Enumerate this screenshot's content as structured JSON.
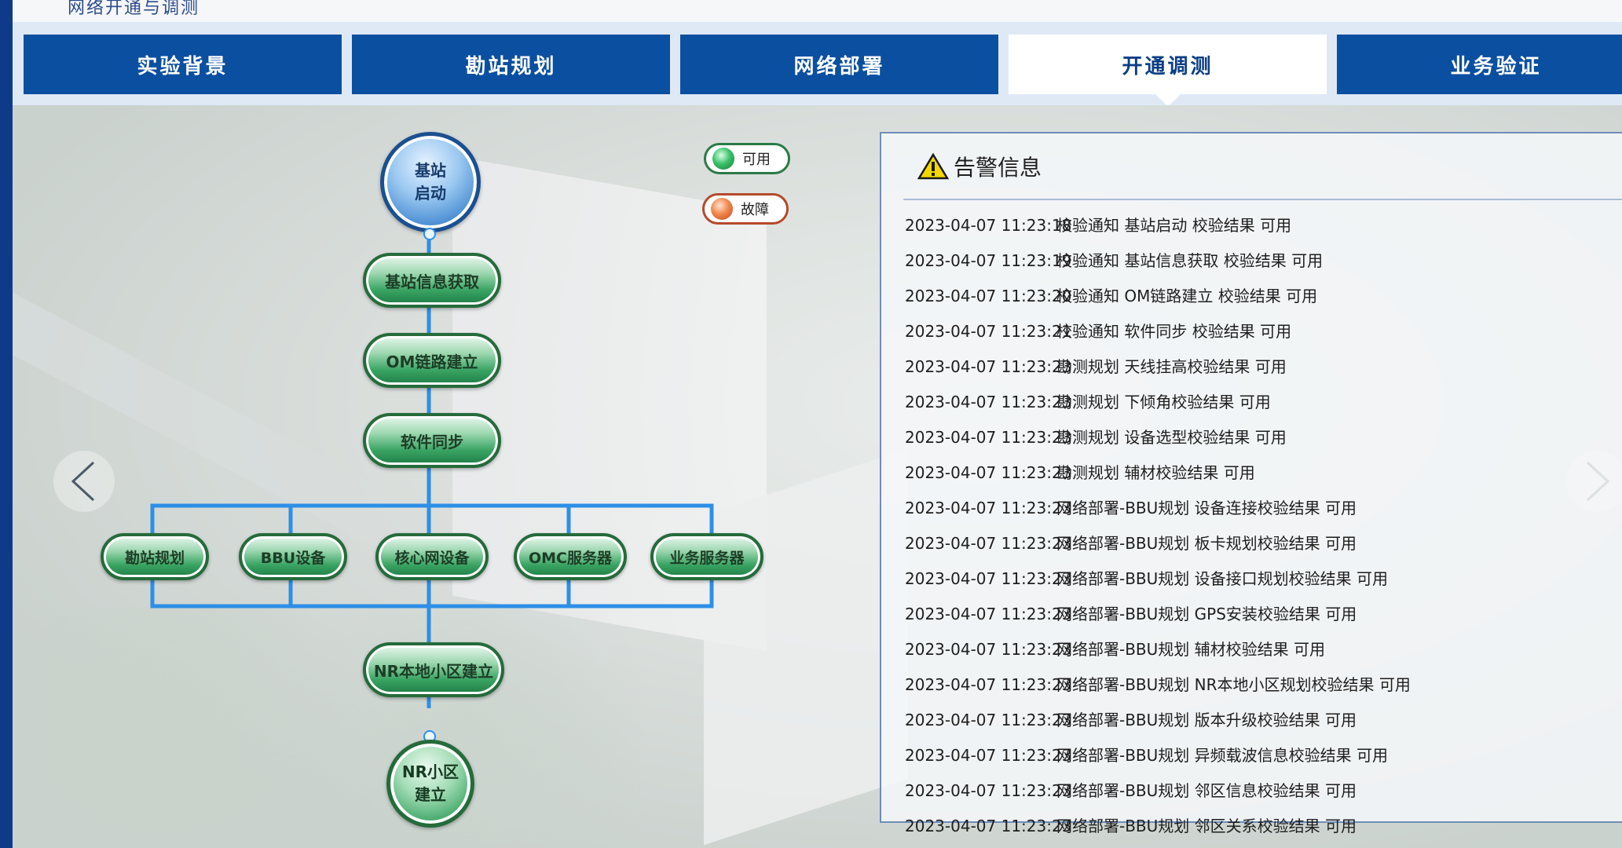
{
  "breadcrumb": "网络开通与调测",
  "tabs": [
    {
      "label": "实验背景",
      "active": false
    },
    {
      "label": "勘站规划",
      "active": false
    },
    {
      "label": "网络部署",
      "active": false
    },
    {
      "label": "开通调测",
      "active": true
    },
    {
      "label": "业务验证",
      "active": false
    }
  ],
  "diagram": {
    "start_line1": "基站",
    "start_line2": "启动",
    "info": "基站信息获取",
    "om": "OM链路建立",
    "sync": "软件同步",
    "branches": [
      "勘站规划",
      "BBU设备",
      "核心网设备",
      "OMC服务器",
      "业务服务器"
    ],
    "nr_local": "NR本地小区建立",
    "end_line1": "NR小区",
    "end_line2": "建立"
  },
  "legend": {
    "ok": "可用",
    "fault": "故障"
  },
  "alarm_panel": {
    "title": "告警信息",
    "logs": [
      {
        "time": "2023-04-07 11:23:18",
        "text": "校验通知 基站启动 校验结果 可用"
      },
      {
        "time": "2023-04-07 11:23:19",
        "text": "校验通知 基站信息获取 校验结果 可用"
      },
      {
        "time": "2023-04-07 11:23:20",
        "text": "校验通知 OM链路建立 校验结果 可用"
      },
      {
        "time": "2023-04-07 11:23:21",
        "text": "校验通知 软件同步 校验结果 可用"
      },
      {
        "time": "2023-04-07 11:23:23",
        "text": "勘测规划 天线挂高校验结果 可用"
      },
      {
        "time": "2023-04-07 11:23:23",
        "text": "勘测规划 下倾角校验结果 可用"
      },
      {
        "time": "2023-04-07 11:23:23",
        "text": "勘测规划 设备选型校验结果 可用"
      },
      {
        "time": "2023-04-07 11:23:23",
        "text": "勘测规划 辅材校验结果 可用"
      },
      {
        "time": "2023-04-07 11:23:23",
        "text": "网络部署-BBU规划 设备连接校验结果 可用"
      },
      {
        "time": "2023-04-07 11:23:23",
        "text": "网络部署-BBU规划 板卡规划校验结果 可用"
      },
      {
        "time": "2023-04-07 11:23:23",
        "text": "网络部署-BBU规划 设备接口规划校验结果 可用"
      },
      {
        "time": "2023-04-07 11:23:23",
        "text": "网络部署-BBU规划 GPS安装校验结果 可用"
      },
      {
        "time": "2023-04-07 11:23:23",
        "text": "网络部署-BBU规划 辅材校验结果 可用"
      },
      {
        "time": "2023-04-07 11:23:23",
        "text": "网络部署-BBU规划 NR本地小区规划校验结果 可用"
      },
      {
        "time": "2023-04-07 11:23:23",
        "text": "网络部署-BBU规划 版本升级校验结果 可用"
      },
      {
        "time": "2023-04-07 11:23:23",
        "text": "网络部署-BBU规划 异频载波信息校验结果 可用"
      },
      {
        "time": "2023-04-07 11:23:23",
        "text": "网络部署-BBU规划 邻区信息校验结果 可用"
      },
      {
        "time": "2023-04-07 11:23:23",
        "text": "网络部署-BBU规划 邻区关系校验结果 可用"
      }
    ]
  },
  "colors": {
    "tab_bg": "#0b4fa0",
    "tab_active_text": "#0b3f86",
    "line": "#2d8fe6",
    "ok": "#3ac26a",
    "fault": "#f2874c"
  }
}
